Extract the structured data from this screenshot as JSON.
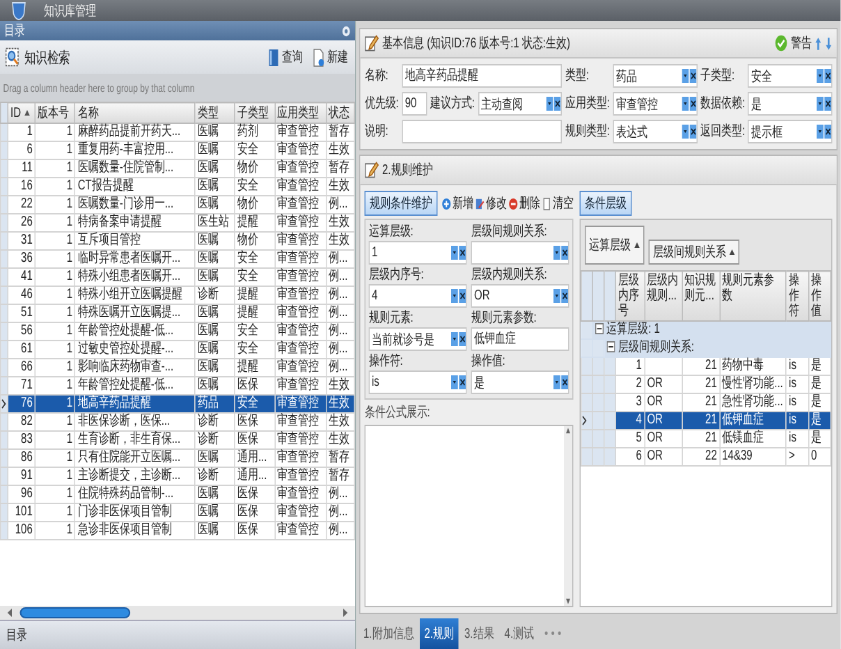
{
  "window": {
    "title": "知识库管理"
  },
  "sidebar": {
    "title": "目录",
    "toolbar_title": "知识检索",
    "buttons": [
      {
        "kind": "query",
        "label": "查询"
      },
      {
        "kind": "new",
        "label": "新建"
      }
    ],
    "group_hint": "Drag a column header here to group by that column",
    "table": {
      "columns": [
        "ID",
        "版本号",
        "名称",
        "类型",
        "子类型",
        "应用类型",
        "状态"
      ],
      "rows": [
        {
          "cells": [
            "1",
            "1",
            "麻醉药品提前开药天...",
            "医嘱",
            "药剂",
            "审查管控",
            "暂存"
          ],
          "selected": false
        },
        {
          "cells": [
            "6",
            "1",
            "重复用药-丰富控用...",
            "医嘱",
            "安全",
            "审查管控",
            "生效"
          ],
          "selected": false
        },
        {
          "cells": [
            "11",
            "1",
            "医嘱数量-住院管制...",
            "医嘱",
            "物价",
            "审查管控",
            "暂存"
          ],
          "selected": false
        },
        {
          "cells": [
            "16",
            "1",
            "CT报告提醒",
            "医嘱",
            "安全",
            "审查管控",
            "生效"
          ],
          "selected": false
        },
        {
          "cells": [
            "22",
            "1",
            "医嘱数量-门诊用一...",
            "医嘱",
            "物价",
            "审查管控",
            "例..."
          ],
          "selected": false
        },
        {
          "cells": [
            "26",
            "1",
            "特病备案申请提醒",
            "医生站",
            "提醒",
            "审查管控",
            "生效"
          ],
          "selected": false
        },
        {
          "cells": [
            "31",
            "1",
            "互斥项目管控",
            "医嘱",
            "物价",
            "审查管控",
            "生效"
          ],
          "selected": false
        },
        {
          "cells": [
            "36",
            "1",
            "临时异常患者医嘱开...",
            "医嘱",
            "安全",
            "审查管控",
            "例..."
          ],
          "selected": false
        },
        {
          "cells": [
            "41",
            "1",
            "特殊小组患者医嘱开...",
            "医嘱",
            "安全",
            "审查管控",
            "例..."
          ],
          "selected": false
        },
        {
          "cells": [
            "46",
            "1",
            "特殊小组开立医嘱提醒",
            "诊断",
            "提醒",
            "审查管控",
            "例..."
          ],
          "selected": false
        },
        {
          "cells": [
            "51",
            "1",
            "特殊医嘱开立医嘱提...",
            "医嘱",
            "提醒",
            "审查管控",
            "例..."
          ],
          "selected": false
        },
        {
          "cells": [
            "56",
            "1",
            "年龄管控处提醒-低...",
            "医嘱",
            "安全",
            "审查管控",
            "例..."
          ],
          "selected": false
        },
        {
          "cells": [
            "61",
            "1",
            "过敏史管控处提醒-...",
            "医嘱",
            "安全",
            "审查管控",
            "例..."
          ],
          "selected": false
        },
        {
          "cells": [
            "66",
            "1",
            "影响临床药物审查-...",
            "医嘱",
            "提醒",
            "审查管控",
            "例..."
          ],
          "selected": false
        },
        {
          "cells": [
            "71",
            "1",
            "年龄管控处提醒-低...",
            "医嘱",
            "医保",
            "审查管控",
            "生效"
          ],
          "selected": false
        },
        {
          "cells": [
            "76",
            "1",
            "地高辛药品提醒",
            "药品",
            "安全",
            "审查管控",
            "生效"
          ],
          "selected": true
        },
        {
          "cells": [
            "82",
            "1",
            "非医保诊断，医保...",
            "诊断",
            "医保",
            "审查管控",
            "生效"
          ],
          "selected": false
        },
        {
          "cells": [
            "83",
            "1",
            "生育诊断，非生育保...",
            "诊断",
            "医保",
            "审查管控",
            "生效"
          ],
          "selected": false
        },
        {
          "cells": [
            "86",
            "1",
            "只有住院能开立医嘱...",
            "医嘱",
            "通用...",
            "审查管控",
            "暂存"
          ],
          "selected": false
        },
        {
          "cells": [
            "91",
            "1",
            "主诊断提交，主诊断...",
            "诊断",
            "通用...",
            "审查管控",
            "暂存"
          ],
          "selected": false
        },
        {
          "cells": [
            "96",
            "1",
            "住院特殊药品管制-...",
            "医嘱",
            "医保",
            "审查管控",
            "例..."
          ],
          "selected": false
        },
        {
          "cells": [
            "101",
            "1",
            "门诊非医保项目管制",
            "医嘱",
            "医保",
            "审查管控",
            "例..."
          ],
          "selected": false
        },
        {
          "cells": [
            "106",
            "1",
            "急诊非医保项目管制",
            "医嘱",
            "医保",
            "审查管控",
            "例..."
          ],
          "selected": false
        }
      ]
    },
    "footer": "目录"
  },
  "basic_info": {
    "title": "基本信息 (知识ID:76 版本号:1 状态:生效)",
    "status": "警告",
    "fields": [
      {
        "label": "名称:",
        "value": "地高辛药品提醒",
        "kind": "wide_text"
      },
      {
        "label": "类型:",
        "value": "药品",
        "kind": "select"
      },
      {
        "label": "子类型:",
        "value": "安全",
        "kind": "select"
      },
      {
        "label": "优先级:",
        "value": "90",
        "kind": "text"
      },
      {
        "label": "建议方式:",
        "value": "主动查阅",
        "kind": "select"
      },
      {
        "label": "应用类型:",
        "value": "审查管控",
        "kind": "select"
      },
      {
        "label": "数据依赖:",
        "value": "是",
        "kind": "select"
      },
      {
        "label": "说明:",
        "kind": "wide_text"
      },
      {
        "label": "规则类型:",
        "value": "表达式",
        "kind": "select"
      },
      {
        "label": "返回类型:",
        "value": "提示框",
        "kind": "select"
      }
    ]
  },
  "rules": {
    "title": "2.规则维护",
    "editor": {
      "tab": "规则条件维护",
      "actions": [
        {
          "kind": "add",
          "label": "新增"
        },
        {
          "kind": "edit",
          "label": "修改"
        },
        {
          "kind": "delete",
          "label": "删除"
        },
        {
          "kind": "clear",
          "label": "清空"
        }
      ],
      "fields": [
        {
          "label": "运算层级:",
          "value": "1",
          "kind": "select"
        },
        {
          "label": "层级间规则关系:",
          "kind": "select"
        },
        {
          "label": "层级内序号:",
          "value": "4",
          "kind": "select"
        },
        {
          "label": "层级内规则关系:",
          "value": "OR",
          "kind": "select"
        },
        {
          "label": "规则元素:",
          "value": "当前就诊号是",
          "kind": "select"
        },
        {
          "label": "规则元素参数:",
          "value": "低钾血症",
          "kind": "text"
        },
        {
          "label": "操作符:",
          "value": "is",
          "kind": "select"
        },
        {
          "label": "操作值:",
          "value": "是",
          "kind": "select"
        }
      ],
      "formula_label": "条件公式展示:"
    },
    "conditions": {
      "tab": "条件层级",
      "group_chips": [
        "运算层级",
        "层级间规则关系"
      ],
      "columns": [
        "层级内序号",
        "层级内规则...",
        "知识规则元...",
        "规则元素参数",
        "操作符",
        "操作值"
      ],
      "groups": [
        {
          "label": "运算层级: 1",
          "expanded": true,
          "children": [
            {
              "label": "层级间规则关系:",
              "expanded": true,
              "rows": [
                {
                  "cells": [
                    "1",
                    "",
                    "21",
                    "药物中毒",
                    "is",
                    "是"
                  ],
                  "selected": false
                },
                {
                  "cells": [
                    "2",
                    "OR",
                    "21",
                    "慢性肾功能...",
                    "is",
                    "是"
                  ],
                  "selected": false
                },
                {
                  "cells": [
                    "3",
                    "OR",
                    "21",
                    "急性肾功能...",
                    "is",
                    "是"
                  ],
                  "selected": false
                },
                {
                  "cells": [
                    "4",
                    "OR",
                    "21",
                    "低钾血症",
                    "is",
                    "是"
                  ],
                  "selected": true
                },
                {
                  "cells": [
                    "5",
                    "OR",
                    "21",
                    "低镁血症",
                    "is",
                    "是"
                  ],
                  "selected": false
                },
                {
                  "cells": [
                    "6",
                    "OR",
                    "22",
                    "14&39",
                    ">",
                    "0"
                  ],
                  "selected": false
                }
              ]
            }
          ]
        }
      ]
    }
  },
  "bottom_tabs": [
    {
      "label": "1.附加信息",
      "selected": false
    },
    {
      "label": "2.规则",
      "selected": true
    },
    {
      "label": "3.结果",
      "selected": false
    },
    {
      "label": "4.测试",
      "selected": false
    }
  ],
  "bottom_more": "• • •"
}
